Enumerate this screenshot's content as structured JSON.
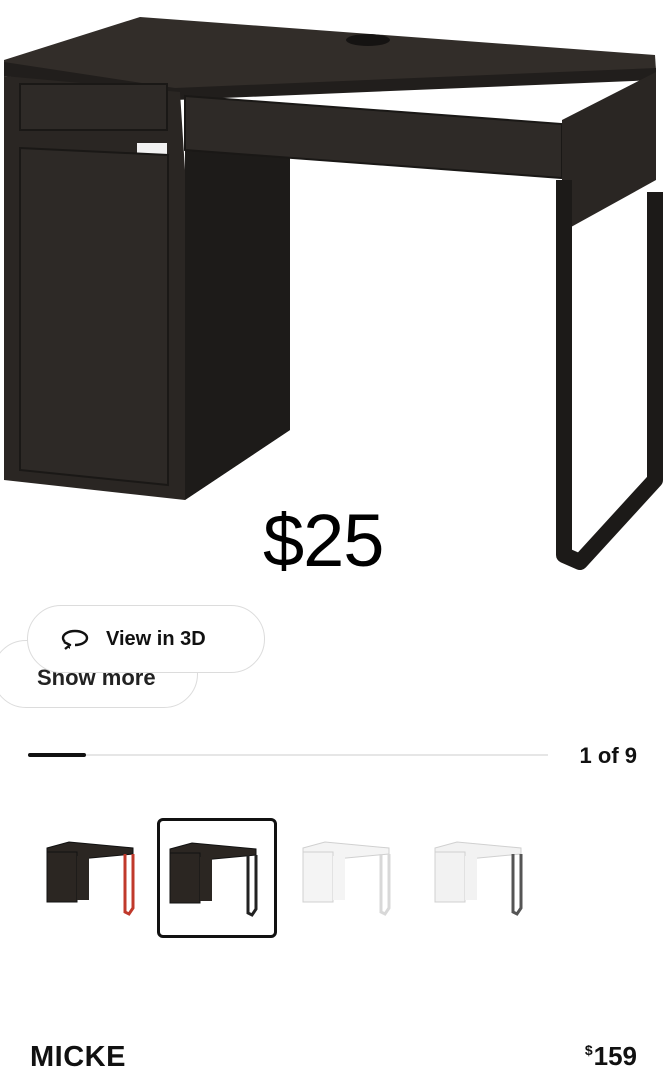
{
  "overlay": {
    "price": "$25"
  },
  "actions": {
    "show_more_label": "Show more",
    "view_3d_label": "View in 3D",
    "view_3d_icon": "rotate-3d-icon"
  },
  "gallery": {
    "counter": "1 of 9",
    "progress_fraction": 0.111,
    "thumbnails": [
      {
        "label": "black-brown desk with red legs",
        "selected": false,
        "top_color": "#2b2622",
        "leg_color": "#c0392b"
      },
      {
        "label": "black-brown desk",
        "selected": true,
        "top_color": "#2b2622",
        "leg_color": "#222222"
      },
      {
        "label": "white desk",
        "selected": false,
        "top_color": "#f4f4f4",
        "leg_color": "#d8d8d8"
      },
      {
        "label": "white and anthracite desk",
        "selected": false,
        "top_color": "#f2f2f2",
        "leg_color": "#555555"
      }
    ]
  },
  "product": {
    "name": "MICKE",
    "currency": "$",
    "price": "159"
  },
  "colors": {
    "desk": "#2b2724",
    "desk_edge": "#1c1a18",
    "accent": "#111111"
  }
}
